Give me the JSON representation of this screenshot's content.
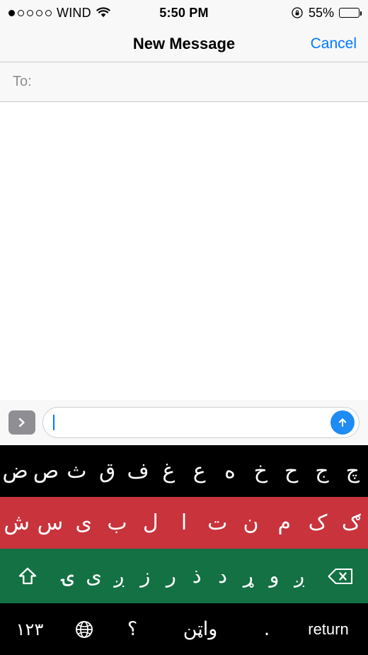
{
  "status_bar": {
    "signal_dots_total": 5,
    "signal_dots_filled": 1,
    "carrier": "WIND",
    "wifi_icon": "wifi-icon",
    "time": "5:50 PM",
    "rotation_lock_icon": "rotation-lock-icon",
    "battery_percent_label": "55%",
    "battery_level": 55
  },
  "nav_bar": {
    "title": "New Message",
    "cancel_label": "Cancel"
  },
  "recipient": {
    "label": "To:",
    "value": "",
    "placeholder": ""
  },
  "input_bar": {
    "expand_icon": "chevron-right-icon",
    "message_value": "",
    "message_placeholder": "",
    "send_icon": "arrow-up-icon"
  },
  "keyboard": {
    "language": "Pashto",
    "colors": {
      "row1_bg": "#000000",
      "row2_bg": "#c8333c",
      "row3_bg": "#137144",
      "row4_bg": "#000000",
      "key_text": "#ffffff"
    },
    "row1": [
      "ض",
      "ص",
      "ث",
      "ق",
      "ف",
      "غ",
      "ع",
      "ه",
      "خ",
      "ح",
      "ج",
      "چ"
    ],
    "row2": [
      "ش",
      "س",
      "ی",
      "ب",
      "ل",
      "ا",
      "ت",
      "ن",
      "م",
      "ک",
      "ګ"
    ],
    "row3": {
      "shift_icon": "shift-icon",
      "letters": [
        "ۍ",
        "ی",
        "ږ",
        "ز",
        "ر",
        "ذ",
        "د",
        "ړ",
        "و",
        "ږ"
      ],
      "backspace_icon": "backspace-icon"
    },
    "row4": {
      "numbers_label": "۱۲۳",
      "globe_icon": "globe-icon",
      "question_label": "؟",
      "space_label": "واټن",
      "period_label": ".",
      "return_label": "return"
    }
  }
}
